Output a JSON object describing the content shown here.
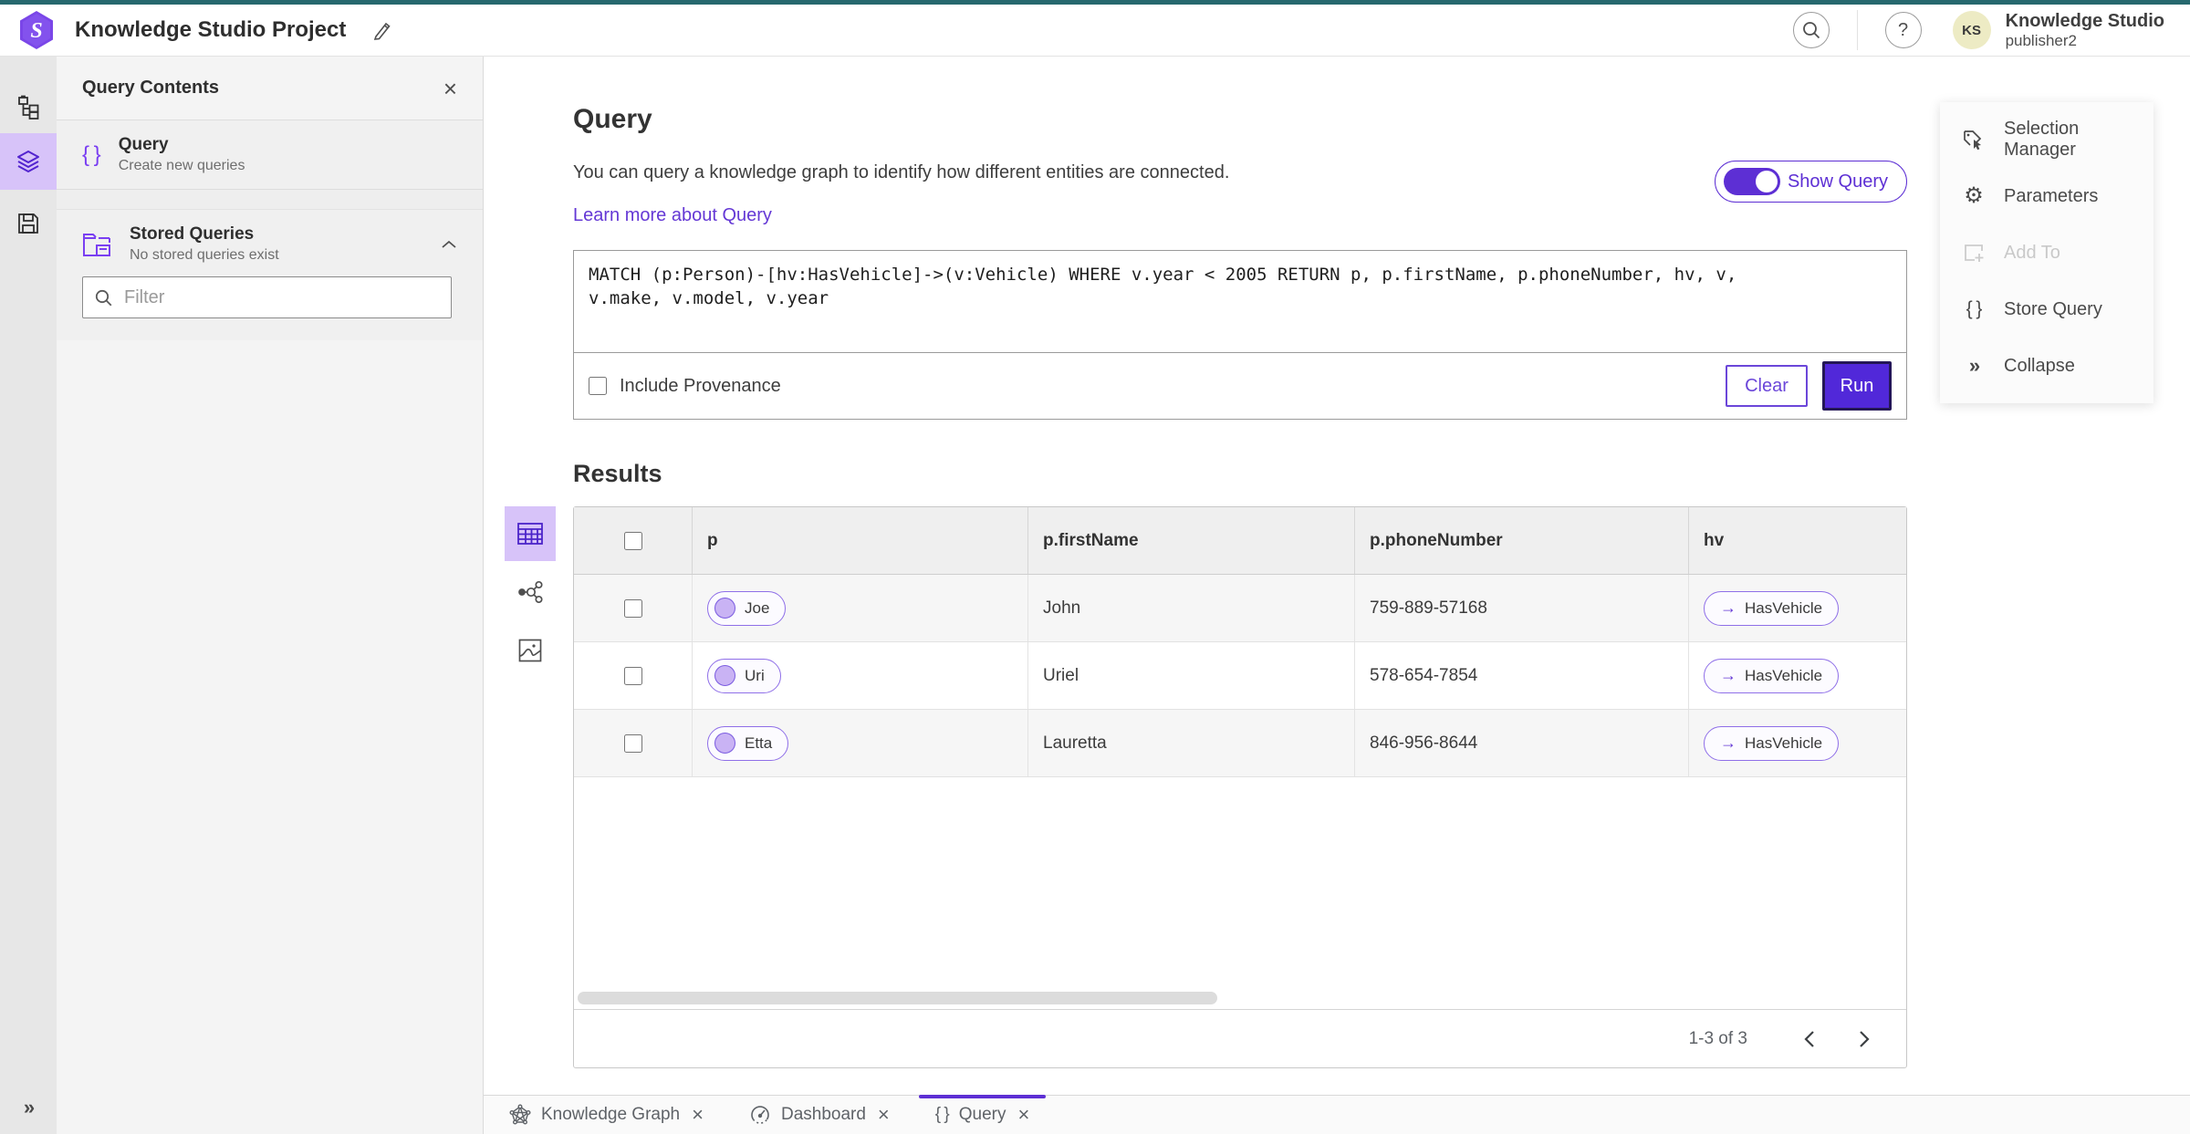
{
  "header": {
    "title": "Knowledge Studio Project",
    "product": "Knowledge Studio",
    "username": "publisher2",
    "avatar_initials": "KS"
  },
  "colors": {
    "accent": "#5d2fd4",
    "accent_light": "#d7c3f9",
    "teal_strip": "#26686e",
    "run_button": "#5128d9"
  },
  "icons": {
    "braces": "{ }",
    "close": "×",
    "help": "?",
    "gear": "⚙",
    "collapse": "»",
    "expand": "»",
    "edge_arrow": "→"
  },
  "panel": {
    "title": "Query Contents",
    "query_item": {
      "title": "Query",
      "subtitle": "Create new queries"
    },
    "stored": {
      "title": "Stored Queries",
      "subtitle": "No stored queries exist"
    },
    "filter_placeholder": "Filter"
  },
  "query": {
    "heading": "Query",
    "description": "You can query a knowledge graph to identify how different entities are connected.",
    "learn_more": "Learn more about Query",
    "show_query": "Show Query",
    "text": "MATCH (p:Person)-[hv:HasVehicle]->(v:Vehicle) WHERE v.year < 2005 RETURN p, p.firstName, p.phoneNumber, hv, v,\nv.make, v.model, v.year",
    "include_provenance": "Include Provenance",
    "clear": "Clear",
    "run": "Run"
  },
  "results": {
    "heading": "Results",
    "columns": [
      "p",
      "p.firstName",
      "p.phoneNumber",
      "hv"
    ],
    "rows": [
      {
        "p": "Joe",
        "firstName": "John",
        "phone": "759-889-57168",
        "hv": "HasVehicle"
      },
      {
        "p": "Uri",
        "firstName": "Uriel",
        "phone": "578-654-7854",
        "hv": "HasVehicle"
      },
      {
        "p": "Etta",
        "firstName": "Lauretta",
        "phone": "846-956-8644",
        "hv": "HasVehicle"
      }
    ],
    "pagination": "1-3 of 3"
  },
  "side_menu": {
    "selection_manager": "Selection Manager",
    "parameters": "Parameters",
    "add_to": "Add To",
    "store_query": "Store Query",
    "collapse": "Collapse"
  },
  "tabs": [
    {
      "label": "Knowledge Graph"
    },
    {
      "label": "Dashboard"
    },
    {
      "label": "Query"
    }
  ]
}
